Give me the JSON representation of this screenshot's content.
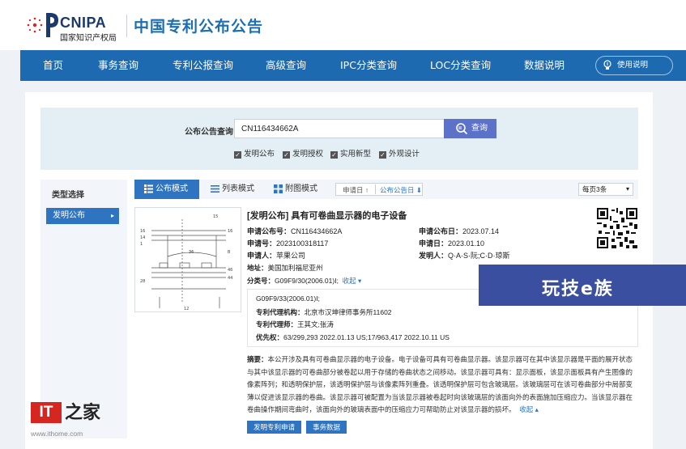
{
  "header": {
    "logo_text": "CNIPA",
    "logo_org": "国家知识产权局",
    "site_title": "中国专利公布公告"
  },
  "nav": {
    "items": [
      "首页",
      "事务查询",
      "专利公报查询",
      "高级查询",
      "IPC分类查询",
      "LOC分类查询",
      "数据说明"
    ],
    "help_label": "使用说明"
  },
  "search": {
    "label": "公布公告查询",
    "value": "CN116434662A",
    "button": "查询",
    "checkboxes": [
      "发明公布",
      "发明授权",
      "实用新型",
      "外观设计"
    ]
  },
  "sidebar": {
    "title": "类型选择",
    "active_item": "发明公布",
    "active_arrow": "▸"
  },
  "toolbar": {
    "modes": [
      "公布模式",
      "列表模式",
      "附图模式"
    ],
    "sort_apply_date": "申请日 ↑",
    "sort_pub_date": "公布公告日 ⬇",
    "per_page": "每页3条"
  },
  "record": {
    "title": "[发明公布] 具有可卷曲显示器的电子设备",
    "pub_no_label": "申请公布号：",
    "pub_no": "CN116434662A",
    "pub_date_label": "申请公布日：",
    "pub_date": "2023.07.14",
    "app_no_label": "申请号：",
    "app_no": "2023100318117",
    "app_date_label": "申请日：",
    "app_date": "2023.01.10",
    "applicant_label": "申请人：",
    "applicant": "苹果公司",
    "inventor_label": "发明人：",
    "inventor": "Q·A·S·阮;C·D·琼斯",
    "address_label": "地址：",
    "address": "美国加利福尼亚州",
    "class_label": "分类号：",
    "class": "G09F9/30(2006.01)I;",
    "collapse": "收起 ▾",
    "class2": "G09F9/33(2006.01)I;",
    "agency_label": "专利代理机构：",
    "agency": "北京市汉坤律师事务所11602",
    "agent_label": "专利代理师：",
    "agent": "王其文;张涛",
    "priority_label": "优先权：",
    "priority": "63/299,293 2022.01.13 US;17/963,417 2022.10.11 US",
    "abstract_label": "摘要：",
    "abstract": "本公开涉及具有可卷曲显示器的电子设备。电子设备可具有可卷曲显示器。该显示器可在其中该显示器是平面的展开状态与其中该显示器的可卷曲部分被卷起以用于存储的卷曲状态之间移动。该显示器可具有：显示面板，该显示面板具有产生图像的像素阵列；和透明保护层，该透明保护层与该像素阵列重叠。该透明保护层可包含玻璃层。该玻璃层可在该可卷曲部分中局部变薄以促进该显示器的卷曲。该显示器可被配置为当该显示器被卷起时向该玻璃层的该面向外的表面施加压缩应力。当该显示器在卷曲操作期间弯曲时，该面向外的玻璃表面中的压缩应力可帮助防止对该显示器的损坏。",
    "abstract_collapse": "收起 ▴",
    "btn_app": "发明专利申请",
    "btn_affairs": "事务数据"
  },
  "figure_labels": [
    "16",
    "14",
    "1",
    "15",
    "16",
    "B",
    "46",
    "44",
    "36",
    "28",
    "12"
  ],
  "overlay_ad": "玩技e族",
  "watermark": {
    "it": "IT",
    "zhi": "之家",
    "url": "www.ithome.com"
  },
  "colors": {
    "nav_bg": "#1d6ab0",
    "accent": "#2f74c0",
    "search_btn": "#5c72c9",
    "title_blue": "#1b6fb0"
  }
}
